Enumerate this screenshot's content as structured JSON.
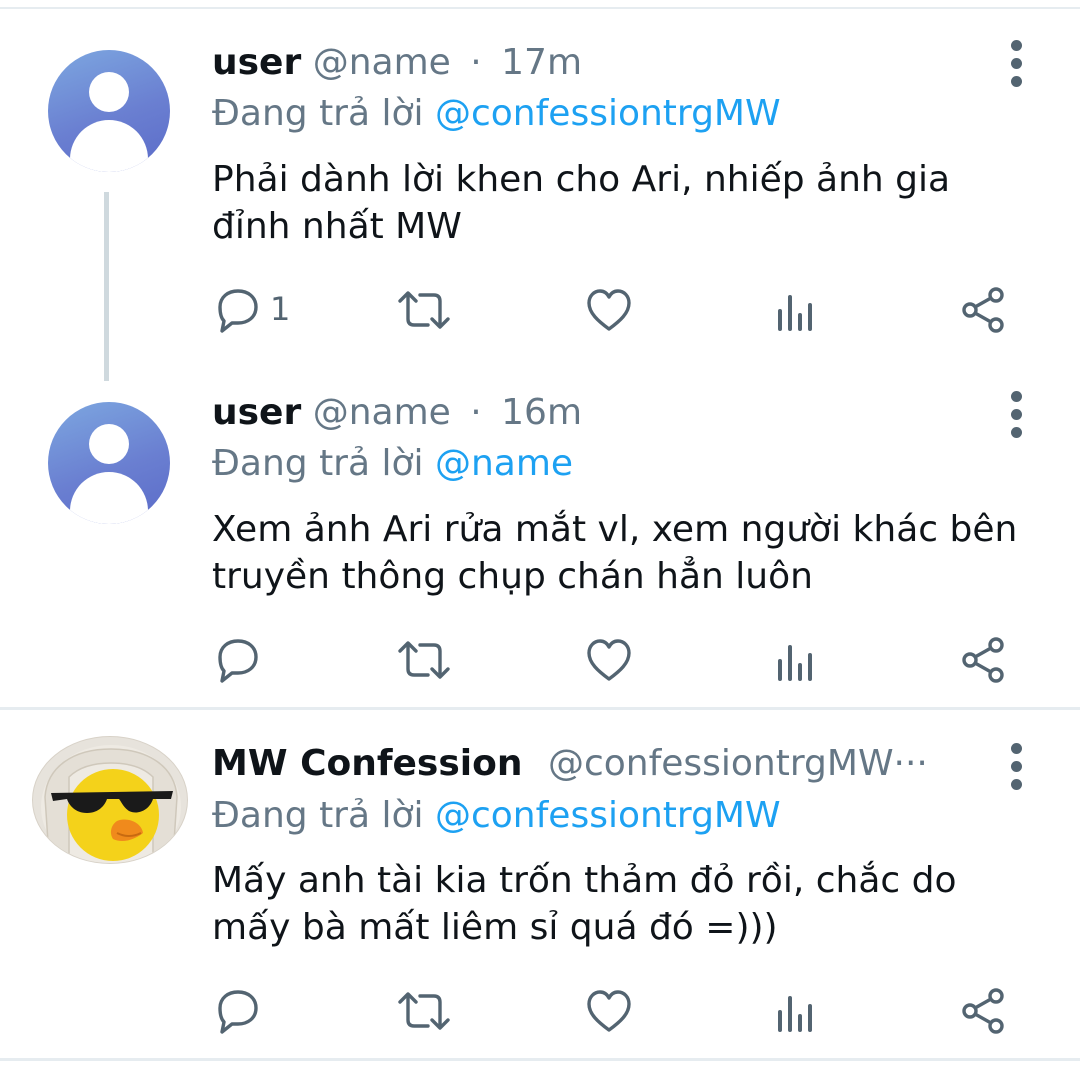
{
  "tweets": [
    {
      "display_name": "user",
      "handle": "@name",
      "separator": "·",
      "time": "17m",
      "reply_prefix": "Đang trả lời",
      "reply_to": "@confessiontrgMW",
      "text": "Phải dành lời khen cho Ari, nhiếp ảnh gia đỉnh nhất MW",
      "reply_count": "1"
    },
    {
      "display_name": "user",
      "handle": "@name",
      "separator": "·",
      "time": "16m",
      "reply_prefix": "Đang trả lời",
      "reply_to": "@name",
      "text": "Xem ảnh Ari rửa mắt vl, xem người khác bên truyền thông chụp chán hẳn luôn",
      "reply_count": ""
    },
    {
      "display_name": "MW Confession",
      "handle": "@confessiontrgMW···",
      "separator": "",
      "time": "",
      "reply_prefix": "Đang trả lời",
      "reply_to": "@confessiontrgMW",
      "text": "Mấy anh tài kia trốn thảm đỏ rồi, chắc do mấy bà mất liêm sỉ quá đó =)))",
      "reply_count": ""
    }
  ],
  "icons": {
    "reply": "reply-icon",
    "retweet": "retweet-icon",
    "like": "heart-icon",
    "analytics": "analytics-icon",
    "share": "share-icon",
    "more": "more-vertical-icon"
  },
  "colors": {
    "mention": "#1da1f2",
    "secondary_text": "#657786",
    "icon": "#536471"
  }
}
